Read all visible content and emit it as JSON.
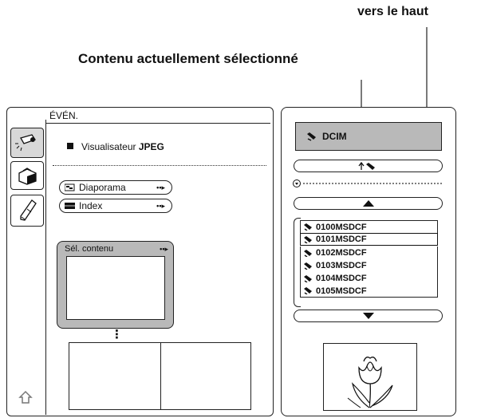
{
  "callouts": {
    "top_right": "vers le haut",
    "middle": "Contenu actuellement sélectionné"
  },
  "left_panel": {
    "tab_title": "ÉVÉN.",
    "viewer_label_prefix": "Visualisateur ",
    "viewer_label_strong": "JPEG",
    "buttons": [
      {
        "label": "Diaporama",
        "icon": "slideshow-icon"
      },
      {
        "label": "Index",
        "icon": "index-icon"
      }
    ],
    "content_select": {
      "label": "Sél. contenu"
    },
    "ellipsis": "⋮",
    "tabs": [
      {
        "icon": "projector-icon"
      },
      {
        "icon": "toolbox-icon"
      },
      {
        "icon": "pen-icon"
      }
    ],
    "home_icon": "home-icon"
  },
  "right_panel": {
    "current_folder": "DCIM",
    "up_button_icon": "folder-up-icon",
    "scroll_up_icon": "triangle-up-icon",
    "scroll_down_icon": "triangle-down-icon",
    "folders": [
      "0100MSDCF",
      "0101MSDCF",
      "0102MSDCF",
      "0103MSDCF",
      "0104MSDCF",
      "0105MSDCF"
    ],
    "selected_index": 1,
    "preview_icon": "tulip-icon"
  }
}
